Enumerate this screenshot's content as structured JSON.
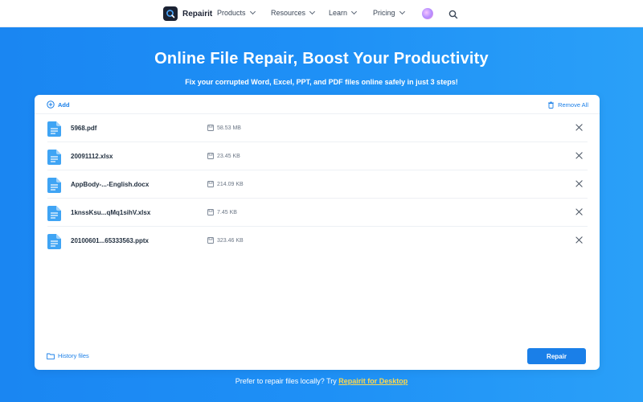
{
  "nav": {
    "brand": "Repairit",
    "items": [
      {
        "label": "Products"
      },
      {
        "label": "Resources"
      },
      {
        "label": "Learn"
      },
      {
        "label": "Pricing"
      }
    ]
  },
  "hero": {
    "title": "Online File Repair, Boost Your Productivity",
    "subtitle": "Fix your corrupted Word, Excel, PPT, and PDF files online safely in just 3 steps!"
  },
  "card": {
    "add_label": "Add",
    "remove_all_label": "Remove All",
    "files": [
      {
        "name": "5968.pdf",
        "size": "58.53 MB"
      },
      {
        "name": "20091112.xlsx",
        "size": "23.45 KB"
      },
      {
        "name": "AppBody-...-English.docx",
        "size": "214.09 KB"
      },
      {
        "name": "1knssKsu...qMq1sihV.xlsx",
        "size": "7.45 KB"
      },
      {
        "name": "20100601...65333563.pptx",
        "size": "323.46 KB"
      }
    ],
    "history_label": "History files",
    "repair_label": "Repair"
  },
  "footer": {
    "prompt": "Prefer to repair files locally? Try ",
    "link": "Repairit for Desktop"
  },
  "colors": {
    "accent": "#1a7fe8",
    "hero_bg": "#1e90f6",
    "link_highlight": "#ffd84a"
  }
}
